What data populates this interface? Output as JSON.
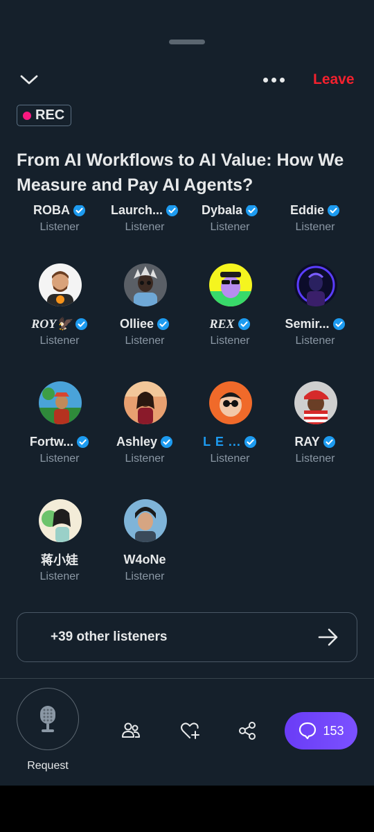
{
  "header": {
    "leave_label": "Leave",
    "rec_label": "REC"
  },
  "space": {
    "title": "From AI Workflows to AI Value: How We Measure and Pay AI Agents?"
  },
  "participants": [
    {
      "name": "ROBA",
      "role": "Listener",
      "verified": true
    },
    {
      "name": "Laurch...",
      "role": "Listener",
      "verified": true
    },
    {
      "name": "Dybala",
      "role": "Listener",
      "verified": true
    },
    {
      "name": "Eddie",
      "role": "Listener",
      "verified": true
    },
    {
      "name": "ROY🦅",
      "role": "Listener",
      "verified": true
    },
    {
      "name": "Olliee",
      "role": "Listener",
      "verified": true
    },
    {
      "name": "REX",
      "role": "Listener",
      "verified": true
    },
    {
      "name": "Semir...",
      "role": "Listener",
      "verified": true
    },
    {
      "name": "Fortw...",
      "role": "Listener",
      "verified": true
    },
    {
      "name": "Ashley",
      "role": "Listener",
      "verified": true
    },
    {
      "name": "L E ...",
      "role": "Listener",
      "verified": true
    },
    {
      "name": "RAY",
      "role": "Listener",
      "verified": true
    },
    {
      "name": "蒋小娃",
      "role": "Listener",
      "verified": false
    },
    {
      "name": "W4oNe",
      "role": "Listener",
      "verified": false
    }
  ],
  "other_listeners": {
    "label": "+39 other listeners"
  },
  "bottom_bar": {
    "request_label": "Request",
    "chat_count": "153",
    "icons": [
      "microphone-icon",
      "people-icon",
      "heart-plus-icon",
      "share-icon",
      "chat-bubble-icon"
    ]
  },
  "colors": {
    "background": "#15202b",
    "leave": "#f4212e",
    "rec_dot": "#f91880",
    "verified": "#1d9bf0",
    "chat_button": "#6a3cf6",
    "muted_text": "#8b98a5"
  }
}
